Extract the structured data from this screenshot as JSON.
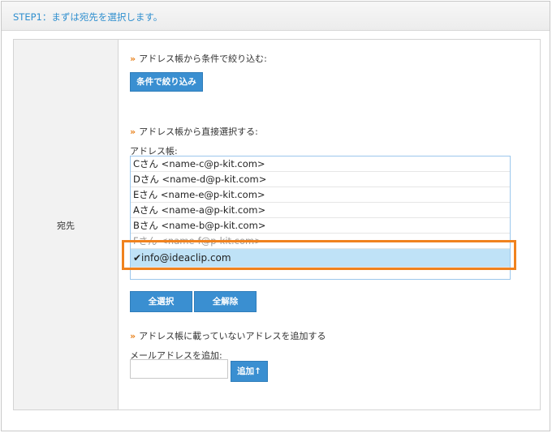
{
  "header": {
    "step": "STEP1：まずは宛先を選択します。"
  },
  "row": {
    "label": "宛先"
  },
  "filter": {
    "raquo": "»",
    "title": "アドレス帳から条件で絞り込む:",
    "button_label": "条件で絞り込み"
  },
  "direct": {
    "raquo": "»",
    "title": "アドレス帳から直接選択する:",
    "address_label": "アドレス帳:",
    "options": [
      "Cさん <name-c@p-kit.com>",
      "Dさん <name-d@p-kit.com>",
      "Eさん <name-e@p-kit.com>",
      "Aさん <name-a@p-kit.com>",
      "Bさん <name-b@p-kit.com>",
      "Fさん <name-f@p-kit.com>",
      "✔info@ideaclip.com"
    ],
    "select_all_label": "全選択",
    "deselect_all_label": "全解除"
  },
  "add": {
    "raquo": "»",
    "title": "アドレス帳に載っていないアドレスを追加する",
    "field_label": "メールアドレスを追加:",
    "input_value": "",
    "button_label": "追加↑"
  },
  "colors": {
    "accent": "#3a8fd1",
    "highlight_border": "#f0821e",
    "selected_row": "#bfe2f7"
  }
}
